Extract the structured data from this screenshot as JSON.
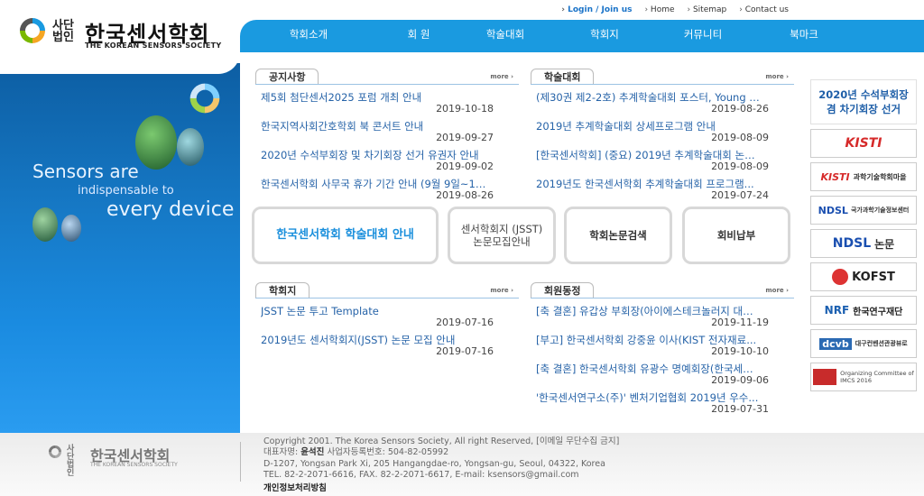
{
  "util": {
    "login": "Login / Join us",
    "home": "Home",
    "sitemap": "Sitemap",
    "contact": "Contact us"
  },
  "logo": {
    "small1": "사단",
    "small2": "법인",
    "name": "한국센서학회",
    "en": "THE KOREAN SENSORS SOCIETY"
  },
  "nav": [
    "학회소개",
    "회 원",
    "학술대회",
    "학회지",
    "커뮤니티",
    "북마크"
  ],
  "hero": {
    "line1": "Sensors are",
    "line2": "indispensable to",
    "line3": "every device"
  },
  "panels": {
    "notice": {
      "title": "공지사항",
      "more": "more",
      "items": [
        {
          "title": "제5회 첨단센서2025 포럼 개최 안내",
          "date": "2019-10-18"
        },
        {
          "title": "한국지역사회간호학회 북 콘서트 안내",
          "date": "2019-09-27"
        },
        {
          "title": "2020년 수석부회장 및 차기회장 선거 유권자 안내",
          "date": "2019-09-02"
        },
        {
          "title": "한국센서학회 사무국 휴가 기간 안내 (9월 9일~13...",
          "date": "2019-08-26"
        }
      ]
    },
    "conference": {
      "title": "학술대회",
      "more": "more",
      "items": [
        {
          "title": "(제30권 제2-2호) 추계학술대회 포스터, Young S...",
          "date": "2019-08-26"
        },
        {
          "title": "2019년 추계학술대회 상세프로그램 안내",
          "date": "2019-08-09"
        },
        {
          "title": "[한국센서학회] (중요) 2019년 추계학술대회 논문...",
          "date": "2019-08-09"
        },
        {
          "title": "2019년도 한국센서학회 추계학술대회 프로그램...",
          "date": "2019-07-24"
        }
      ]
    },
    "journal": {
      "title": "학회지",
      "more": "more",
      "items": [
        {
          "title": "JSST 논문 투고 Template",
          "date": "2019-07-16"
        },
        {
          "title": "2019년도 센서학회지(JSST) 논문 모집 안내",
          "date": "2019-07-16"
        }
      ]
    },
    "members": {
      "title": "회원동정",
      "more": "more",
      "items": [
        {
          "title": "[축 결혼] 유갑상 부회장(아이에스테크놀러지 대표...",
          "date": "2019-11-19"
        },
        {
          "title": "[부고] 한국센서학회 강중윤 이사(KIST 전자재료...",
          "date": "2019-10-10"
        },
        {
          "title": "[축 결혼] 한국센서학회 유광수 명예회장(한국세라...",
          "date": "2019-09-06"
        },
        {
          "title": "'한국센서연구소(주)' 벤처기업협회 2019년 우수...",
          "date": "2019-07-31"
        }
      ]
    }
  },
  "quick": {
    "b1": "한국센서학회 학술대회 안내",
    "b2a": "센서학회지 (JSST)",
    "b2b": "논문모집안내",
    "b3": "학회논문검색",
    "b4": "회비납부"
  },
  "side": {
    "election1": "2020년 수석부회장",
    "election2": "겸 차기회장 선거",
    "kisti": "KISTI",
    "kisti2": "과학기술학회마을",
    "ndsl1": "NDSL",
    "ndsl1b": "국가과학기술정보센터",
    "ndsl2": "NDSL",
    "ndsl2b": "논문",
    "kofst": "KOFST",
    "nrf": "NRF",
    "nrf2": "한국연구재단",
    "dcvb": "dcvb",
    "dcvb2": "대구컨벤션관광뷰로",
    "imcs1": "Organizing Committee of",
    "imcs2": "IMCS 2016"
  },
  "footer": {
    "copyright": "Copyright 2001. The Korea Sensors Society, All right Reserved, [이메일 무단수집 금지]",
    "ceo_label": "대표자명: ",
    "ceo": "윤석진",
    "bizno": " 사업자등록번호: 504-82-05992",
    "address": "D-1207, Yongsan Park Xi, 205 Hangangdae-ro, Yongsan-gu, Seoul, 04322, Korea",
    "contact": "TEL. 82-2-2071-6616, FAX. 82-2-2071-6617, E-mail: ksensors@gmail.com",
    "privacy": "개인정보처리방침"
  },
  "colors": {
    "accent": "#1a9ae0",
    "link": "#2663a8"
  }
}
